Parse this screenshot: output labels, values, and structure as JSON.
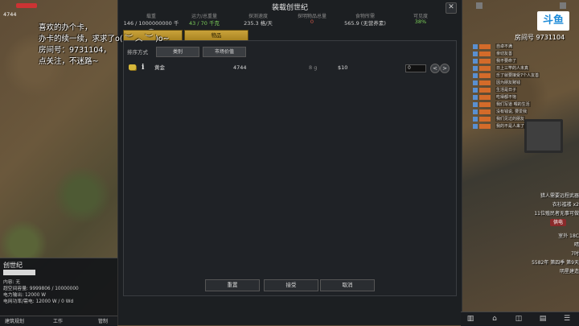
{
  "caption_lines": [
    "喜欢的办个卡，",
    "办卡的续一续，求求了o( ︶ ︿ ︶ )o~",
    "房间号：9731104，",
    "点关注，不迷路~"
  ],
  "top_left": {
    "resource_value": "4744"
  },
  "dialog": {
    "title": "装载创世纪",
    "close_glyph": "✕",
    "stats": [
      {
        "label": "载重",
        "value": "146 / 1000000000 千克",
        "color": "#cfcfcf"
      },
      {
        "label": "运力/总重量",
        "value": "43 / 70 千克",
        "color": "#7ccf5a"
      },
      {
        "label": "探测速度",
        "value": "235.3 格/天",
        "color": "#cfcfcf"
      },
      {
        "label": "探明物品总量",
        "value": "0",
        "color": "#d65a4a"
      },
      {
        "label": "食物所需",
        "value": "565.9 (无营养素)",
        "color": "#cfcfcf"
      },
      {
        "label": "可见度",
        "value": "38%",
        "color": "#7ccf5a"
      }
    ],
    "tabs": [
      {
        "label": ""
      },
      {
        "label": "物品"
      }
    ],
    "sort_label": "排序方式",
    "sort_buttons": [
      "类别",
      "市场价值"
    ],
    "items": [
      {
        "name": "黄金",
        "count": "4744",
        "mass": "8 g",
        "price": "$10",
        "input": "0",
        "info": "i"
      }
    ],
    "adjust_labels": [
      "<",
      ">"
    ],
    "footer": {
      "reset": "重置",
      "accept": "接受",
      "cancel": "取消"
    }
  },
  "inspect": {
    "title": "创世纪",
    "lines": [
      "内容: 无",
      "超空间容量: 9999806 / 10000000",
      "电力输出: 12000 W",
      "电网功率/需电: 12000 W / 0 Wd"
    ]
  },
  "bottom_tabs": [
    "建筑规划",
    "工作",
    "管制"
  ],
  "right": {
    "brand": "斗鱼",
    "room_label": "房间号",
    "room_id": "9731104",
    "list": [
      "自卓不满",
      "亲切友善",
      "我不要命了",
      "日上三竿的人未真",
      "乐了就要接受7个人友善",
      "因为朋友赌钱",
      "生活是日子",
      "吃得都不饱",
      "我们写道 喂的生活",
      "没有钱说, 要爱我",
      "我们见过的朋友",
      "我的不是人来了"
    ],
    "stats": [
      "猎人需要远程武器",
      "衣衫褴褛 x2",
      "11位殖民者无事可做",
      "供电",
      "室外 18C",
      "晴",
      "7时",
      "5582年 第四季 第9天",
      "明星建造"
    ],
    "bottom_icons": [
      "▥",
      "⌂",
      "◫",
      "▤",
      "☰"
    ]
  }
}
